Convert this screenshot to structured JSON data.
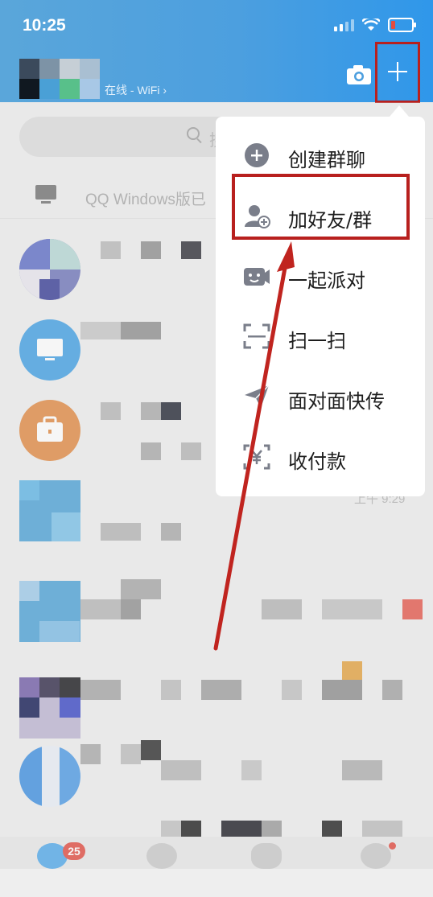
{
  "status_bar": {
    "time": "10:25"
  },
  "header": {
    "status_text": "在线 - WiFi ›"
  },
  "search": {
    "placeholder": "搜"
  },
  "device_banner": {
    "text": "QQ Windows版已"
  },
  "menu": {
    "items": [
      {
        "label": "创建群聊",
        "icon": "add-circle-icon"
      },
      {
        "label": "加好友/群",
        "icon": "add-friend-icon"
      },
      {
        "label": "一起派对",
        "icon": "party-icon"
      },
      {
        "label": "扫一扫",
        "icon": "scan-icon"
      },
      {
        "label": "面对面快传",
        "icon": "send-icon"
      },
      {
        "label": "收付款",
        "icon": "payment-icon"
      }
    ]
  },
  "chat_list": {
    "row_times": [
      "",
      "",
      "",
      "上午 9:29",
      "",
      "",
      "",
      ""
    ]
  },
  "tab_bar": {
    "messages_badge": "25"
  },
  "colors": {
    "header": "#4c9fdf",
    "highlight": "#b8201e",
    "arrow": "#c0241f"
  }
}
